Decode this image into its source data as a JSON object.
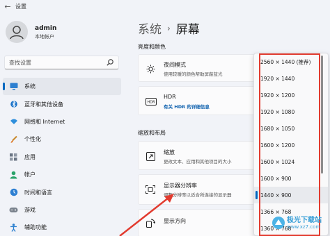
{
  "app": {
    "title": "设置"
  },
  "user": {
    "name": "admin",
    "account_type": "本地帐户"
  },
  "search": {
    "placeholder": "查找设置"
  },
  "sidebar": {
    "items": [
      {
        "label": "系统",
        "icon": "monitor-icon",
        "active": true
      },
      {
        "label": "蓝牙和其他设备",
        "icon": "bluetooth-icon"
      },
      {
        "label": "网络和 Internet",
        "icon": "wifi-icon"
      },
      {
        "label": "个性化",
        "icon": "brush-icon"
      },
      {
        "label": "应用",
        "icon": "apps-icon"
      },
      {
        "label": "帐户",
        "icon": "person-icon"
      },
      {
        "label": "时间和语言",
        "icon": "globe-clock-icon"
      },
      {
        "label": "游戏",
        "icon": "gamepad-icon"
      },
      {
        "label": "辅助功能",
        "icon": "accessibility-icon"
      }
    ]
  },
  "breadcrumb": {
    "parent": "系统",
    "separator": "›",
    "current": "屏幕"
  },
  "sections": {
    "brightness": "亮度和颜色",
    "scale_layout": "缩放和布局"
  },
  "cards": {
    "night_light": {
      "title": "夜间模式",
      "subtitle": "使用较暖的颜色帮助屏蔽蓝光"
    },
    "hdr": {
      "title": "HDR",
      "link": "有关 HDR 的详细信息",
      "icon_text": "HDR"
    },
    "scale": {
      "title": "缩放",
      "subtitle": "更改文本、应用和其他项目的大小"
    },
    "resolution": {
      "title": "显示器分辨率",
      "subtitle": "调整分辨率以适合所连接的显示器"
    },
    "orientation": {
      "title": "显示方向"
    }
  },
  "resolution_dropdown": {
    "options": [
      "2560 × 1440 (推荐)",
      "1920 × 1440",
      "1920 × 1200",
      "1920 × 1080",
      "1680 × 1050",
      "1600 × 1200",
      "1600 × 1024",
      "1600 × 900",
      "1440 × 900",
      "1366 × 768",
      "1360 × 768"
    ],
    "selected_index": 8
  },
  "watermark": {
    "title": "极光下载站",
    "url": "www.xz7.com"
  },
  "colors": {
    "accent": "#0067c0",
    "annotation_red": "#e23b2f",
    "link": "#0b5fad"
  }
}
